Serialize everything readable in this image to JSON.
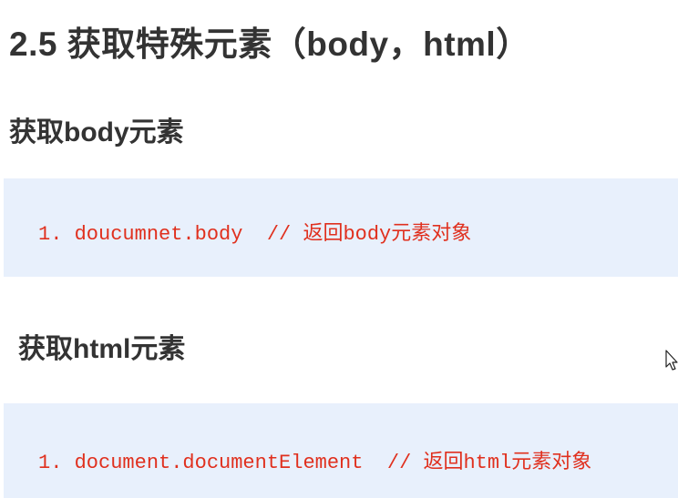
{
  "title": "2.5 获取特殊元素（body，html）",
  "sections": [
    {
      "heading": "获取body元素",
      "code": "1. doucumnet.body  // 返回body元素对象"
    },
    {
      "heading": "获取html元素",
      "code": "1. document.documentElement  // 返回html元素对象"
    }
  ],
  "colors": {
    "code_text": "#e0301e",
    "code_background": "#e8f0fc",
    "heading_text": "#333333"
  },
  "icons": [
    "mouse-pointer-icon"
  ]
}
